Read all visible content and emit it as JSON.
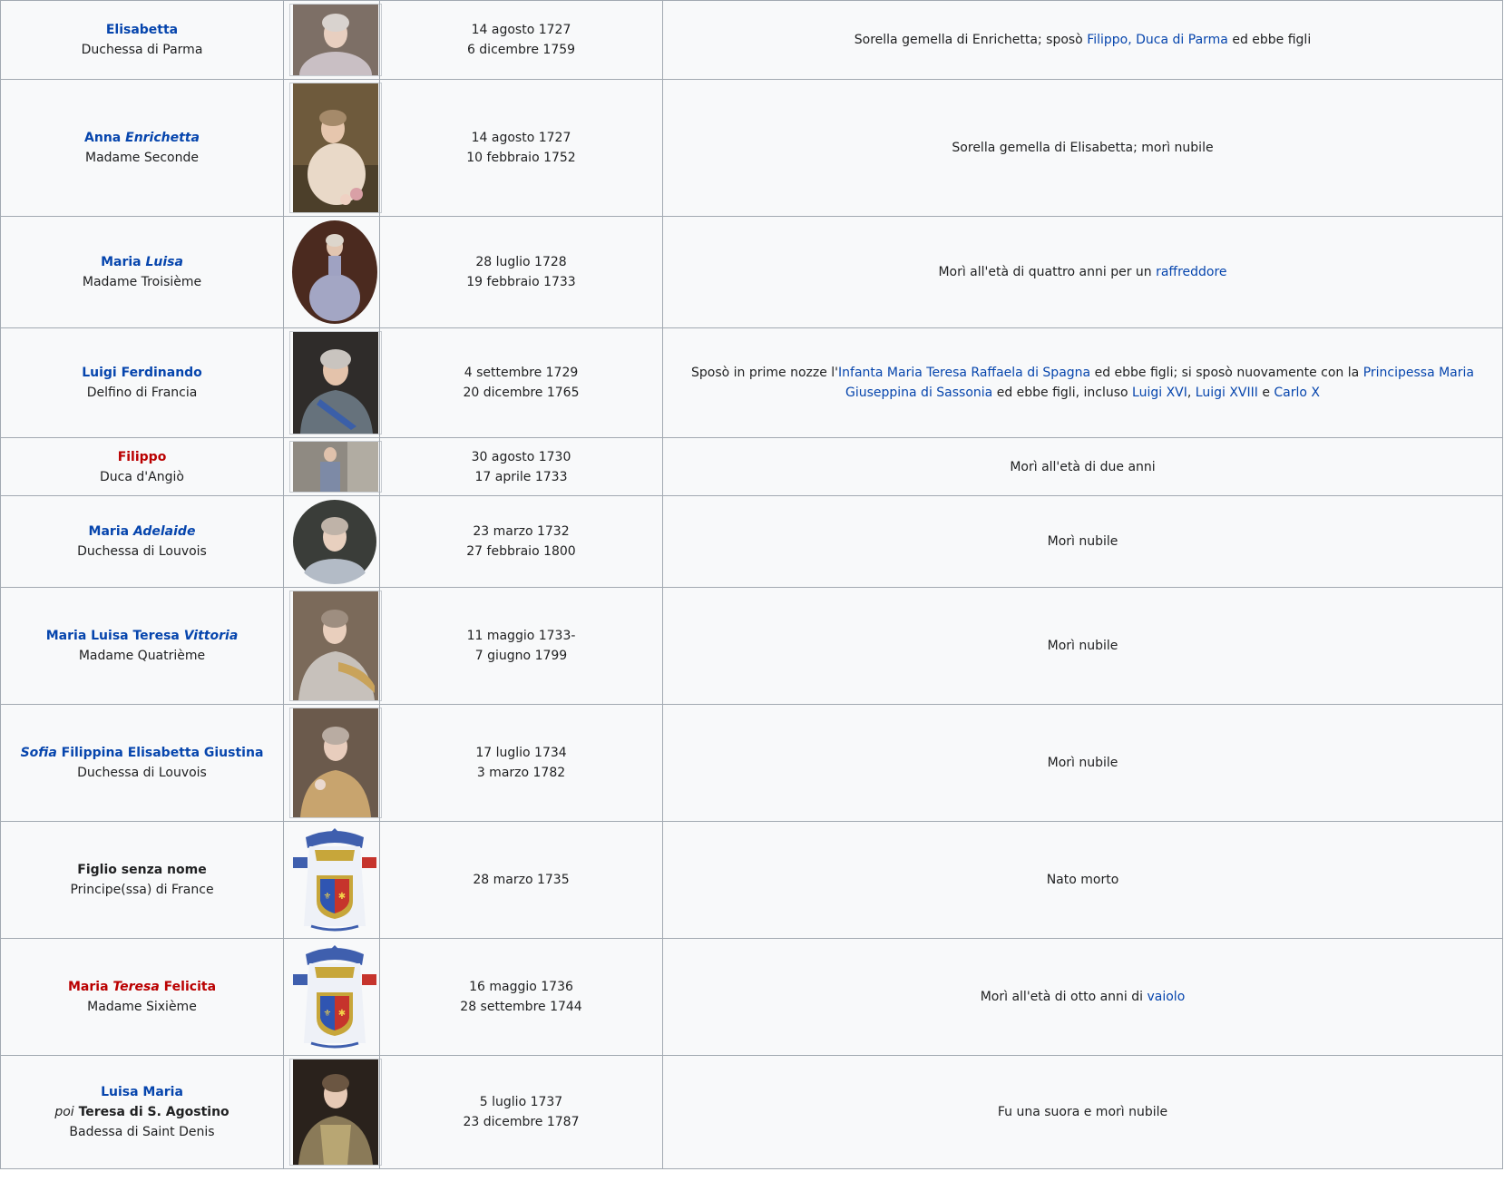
{
  "rows": [
    {
      "name_segments": [
        {
          "text": "Elisabetta",
          "italic": false
        }
      ],
      "name_color": "blue",
      "title": "Duchessa di Parma",
      "birth": "14 agosto 1727",
      "death": "6 dicembre 1759",
      "notes": [
        {
          "text": "Sorella gemella di Enrichetta; sposò ",
          "link": false
        },
        {
          "text": "Filippo, Duca di Parma",
          "link": true
        },
        {
          "text": " ed ebbe figli",
          "link": false
        }
      ]
    },
    {
      "name_segments": [
        {
          "text": "Anna ",
          "italic": false
        },
        {
          "text": "Enrichetta",
          "italic": true
        }
      ],
      "name_color": "blue",
      "title": "Madame Seconde",
      "birth": "14 agosto 1727",
      "death": "10 febbraio 1752",
      "notes": [
        {
          "text": "Sorella gemella di Elisabetta; morì nubile",
          "link": false
        }
      ]
    },
    {
      "name_segments": [
        {
          "text": "Maria ",
          "italic": false
        },
        {
          "text": "Luisa",
          "italic": true
        }
      ],
      "name_color": "blue",
      "title": "Madame Troisième",
      "birth": "28 luglio 1728",
      "death": "19 febbraio 1733",
      "notes": [
        {
          "text": "Morì all'età di quattro anni per un ",
          "link": false
        },
        {
          "text": "raffreddore",
          "link": true
        }
      ]
    },
    {
      "name_segments": [
        {
          "text": "Luigi Ferdinando",
          "italic": false
        }
      ],
      "name_color": "blue",
      "title": "Delfino di Francia",
      "birth": "4 settembre 1729",
      "death": "20 dicembre 1765",
      "notes": [
        {
          "text": "Sposò in prime nozze l'",
          "link": false
        },
        {
          "text": "Infanta Maria Teresa Raffaela di Spagna",
          "link": true
        },
        {
          "text": " ed ebbe figli; si sposò nuovamente con la ",
          "link": false
        },
        {
          "text": "Principessa Maria Giuseppina di Sassonia",
          "link": true
        },
        {
          "text": " ed ebbe figli, incluso ",
          "link": false
        },
        {
          "text": "Luigi XVI",
          "link": true
        },
        {
          "text": ", ",
          "link": false
        },
        {
          "text": "Luigi XVIII",
          "link": true
        },
        {
          "text": " e ",
          "link": false
        },
        {
          "text": "Carlo X",
          "link": true
        }
      ]
    },
    {
      "name_segments": [
        {
          "text": "Filippo",
          "italic": false
        }
      ],
      "name_color": "red",
      "title": "Duca d'Angiò",
      "birth": "30 agosto 1730",
      "death": "17 aprile 1733",
      "notes": [
        {
          "text": "Morì all'età di due anni",
          "link": false
        }
      ]
    },
    {
      "name_segments": [
        {
          "text": "Maria ",
          "italic": false
        },
        {
          "text": "Adelaide",
          "italic": true
        }
      ],
      "name_color": "blue",
      "title": "Duchessa di Louvois",
      "birth": "23 marzo 1732",
      "death": "27 febbraio 1800",
      "notes": [
        {
          "text": "Morì nubile",
          "link": false
        }
      ]
    },
    {
      "name_segments": [
        {
          "text": "Maria Luisa Teresa ",
          "italic": false
        },
        {
          "text": "Vittoria",
          "italic": true
        }
      ],
      "name_color": "blue",
      "title": "Madame Quatrième",
      "birth": "11 maggio 1733-",
      "death": "7 giugno 1799",
      "notes": [
        {
          "text": "Morì nubile",
          "link": false
        }
      ]
    },
    {
      "name_segments": [
        {
          "text": "Sofia",
          "italic": true
        },
        {
          "text": " Filippina Elisabetta Giustina",
          "italic": false
        }
      ],
      "name_color": "blue",
      "title": "Duchessa di Louvois",
      "birth": "17 luglio 1734",
      "death": "3 marzo 1782",
      "notes": [
        {
          "text": "Morì nubile",
          "link": false
        }
      ]
    },
    {
      "name_segments": [
        {
          "text": "Figlio senza nome",
          "italic": false
        }
      ],
      "name_color": "black",
      "title": "Principe(ssa) di France",
      "birth": "28 marzo 1735",
      "death": "",
      "notes": [
        {
          "text": "Nato morto",
          "link": false
        }
      ]
    },
    {
      "name_segments": [
        {
          "text": "Maria ",
          "italic": false
        },
        {
          "text": "Teresa",
          "italic": true
        },
        {
          "text": " Felicita",
          "italic": false
        }
      ],
      "name_color": "red",
      "title": "Madame Sixième",
      "birth": "16 maggio 1736",
      "death": "28 settembre 1744",
      "notes": [
        {
          "text": "Morì all'età di otto anni di ",
          "link": false
        },
        {
          "text": "vaiolo",
          "link": true
        }
      ]
    },
    {
      "name_segments": [
        {
          "text": "Luisa Maria",
          "italic": false
        }
      ],
      "name_color": "blue",
      "alt_prefix": "poi",
      "alt_name": "Teresa di S. Agostino",
      "title": "Badessa di Saint Denis",
      "birth": "5 luglio 1737",
      "death": "23 dicembre 1787",
      "notes": [
        {
          "text": "Fu una suora e morì nubile",
          "link": false
        }
      ]
    }
  ]
}
